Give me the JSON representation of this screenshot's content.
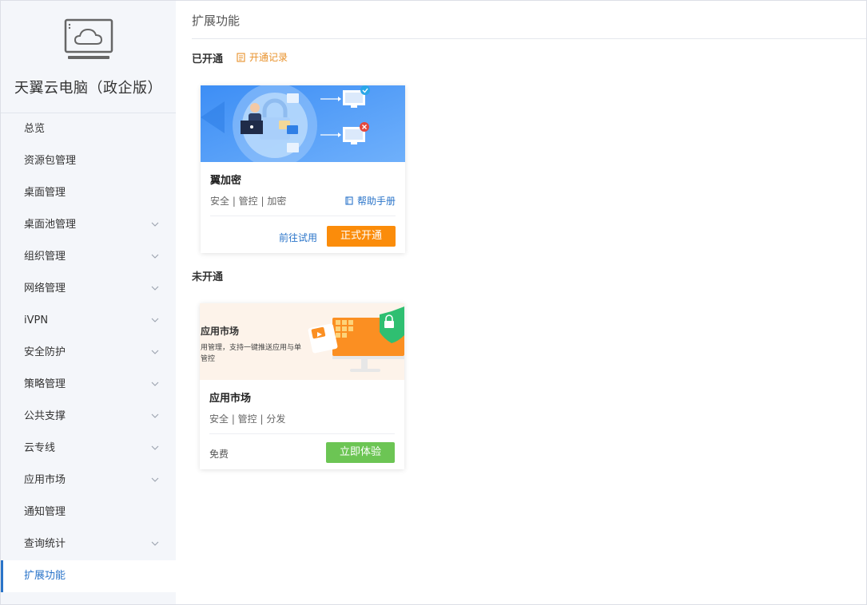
{
  "sidebar": {
    "brand_title": "天翼云电脑（政企版）",
    "items": [
      {
        "label": "总览",
        "expandable": false,
        "active": false
      },
      {
        "label": "资源包管理",
        "expandable": false,
        "active": false
      },
      {
        "label": "桌面管理",
        "expandable": false,
        "active": false
      },
      {
        "label": "桌面池管理",
        "expandable": true,
        "active": false
      },
      {
        "label": "组织管理",
        "expandable": true,
        "active": false
      },
      {
        "label": "网络管理",
        "expandable": true,
        "active": false
      },
      {
        "label": "iVPN",
        "expandable": true,
        "active": false
      },
      {
        "label": "安全防护",
        "expandable": true,
        "active": false
      },
      {
        "label": "策略管理",
        "expandable": true,
        "active": false
      },
      {
        "label": "公共支撑",
        "expandable": true,
        "active": false
      },
      {
        "label": "云专线",
        "expandable": true,
        "active": false
      },
      {
        "label": "应用市场",
        "expandable": true,
        "active": false
      },
      {
        "label": "通知管理",
        "expandable": false,
        "active": false
      },
      {
        "label": "查询统计",
        "expandable": true,
        "active": false
      },
      {
        "label": "扩展功能",
        "expandable": false,
        "active": true
      }
    ]
  },
  "main": {
    "title": "扩展功能",
    "activated": {
      "label": "已开通",
      "record_link": "开通记录"
    },
    "not_activated": {
      "label": "未开通"
    },
    "cards": {
      "encryption": {
        "title": "翼加密",
        "tags": "安全 | 管控 | 加密",
        "help_link": "帮助手册",
        "try_link": "前往试用",
        "primary_button": "正式开通"
      },
      "app_market": {
        "banner_title": "应用市场",
        "banner_desc": "用管理，支持一键推送应用与单管控",
        "title": "应用市场",
        "tags": "安全 | 管控 | 分发",
        "price": "免费",
        "primary_button": "立即体验"
      }
    }
  },
  "colors": {
    "accent_blue": "#2a74c9",
    "orange": "#fb8c0a",
    "green": "#6cc554",
    "sidebar_bg": "#f4f6fa"
  }
}
